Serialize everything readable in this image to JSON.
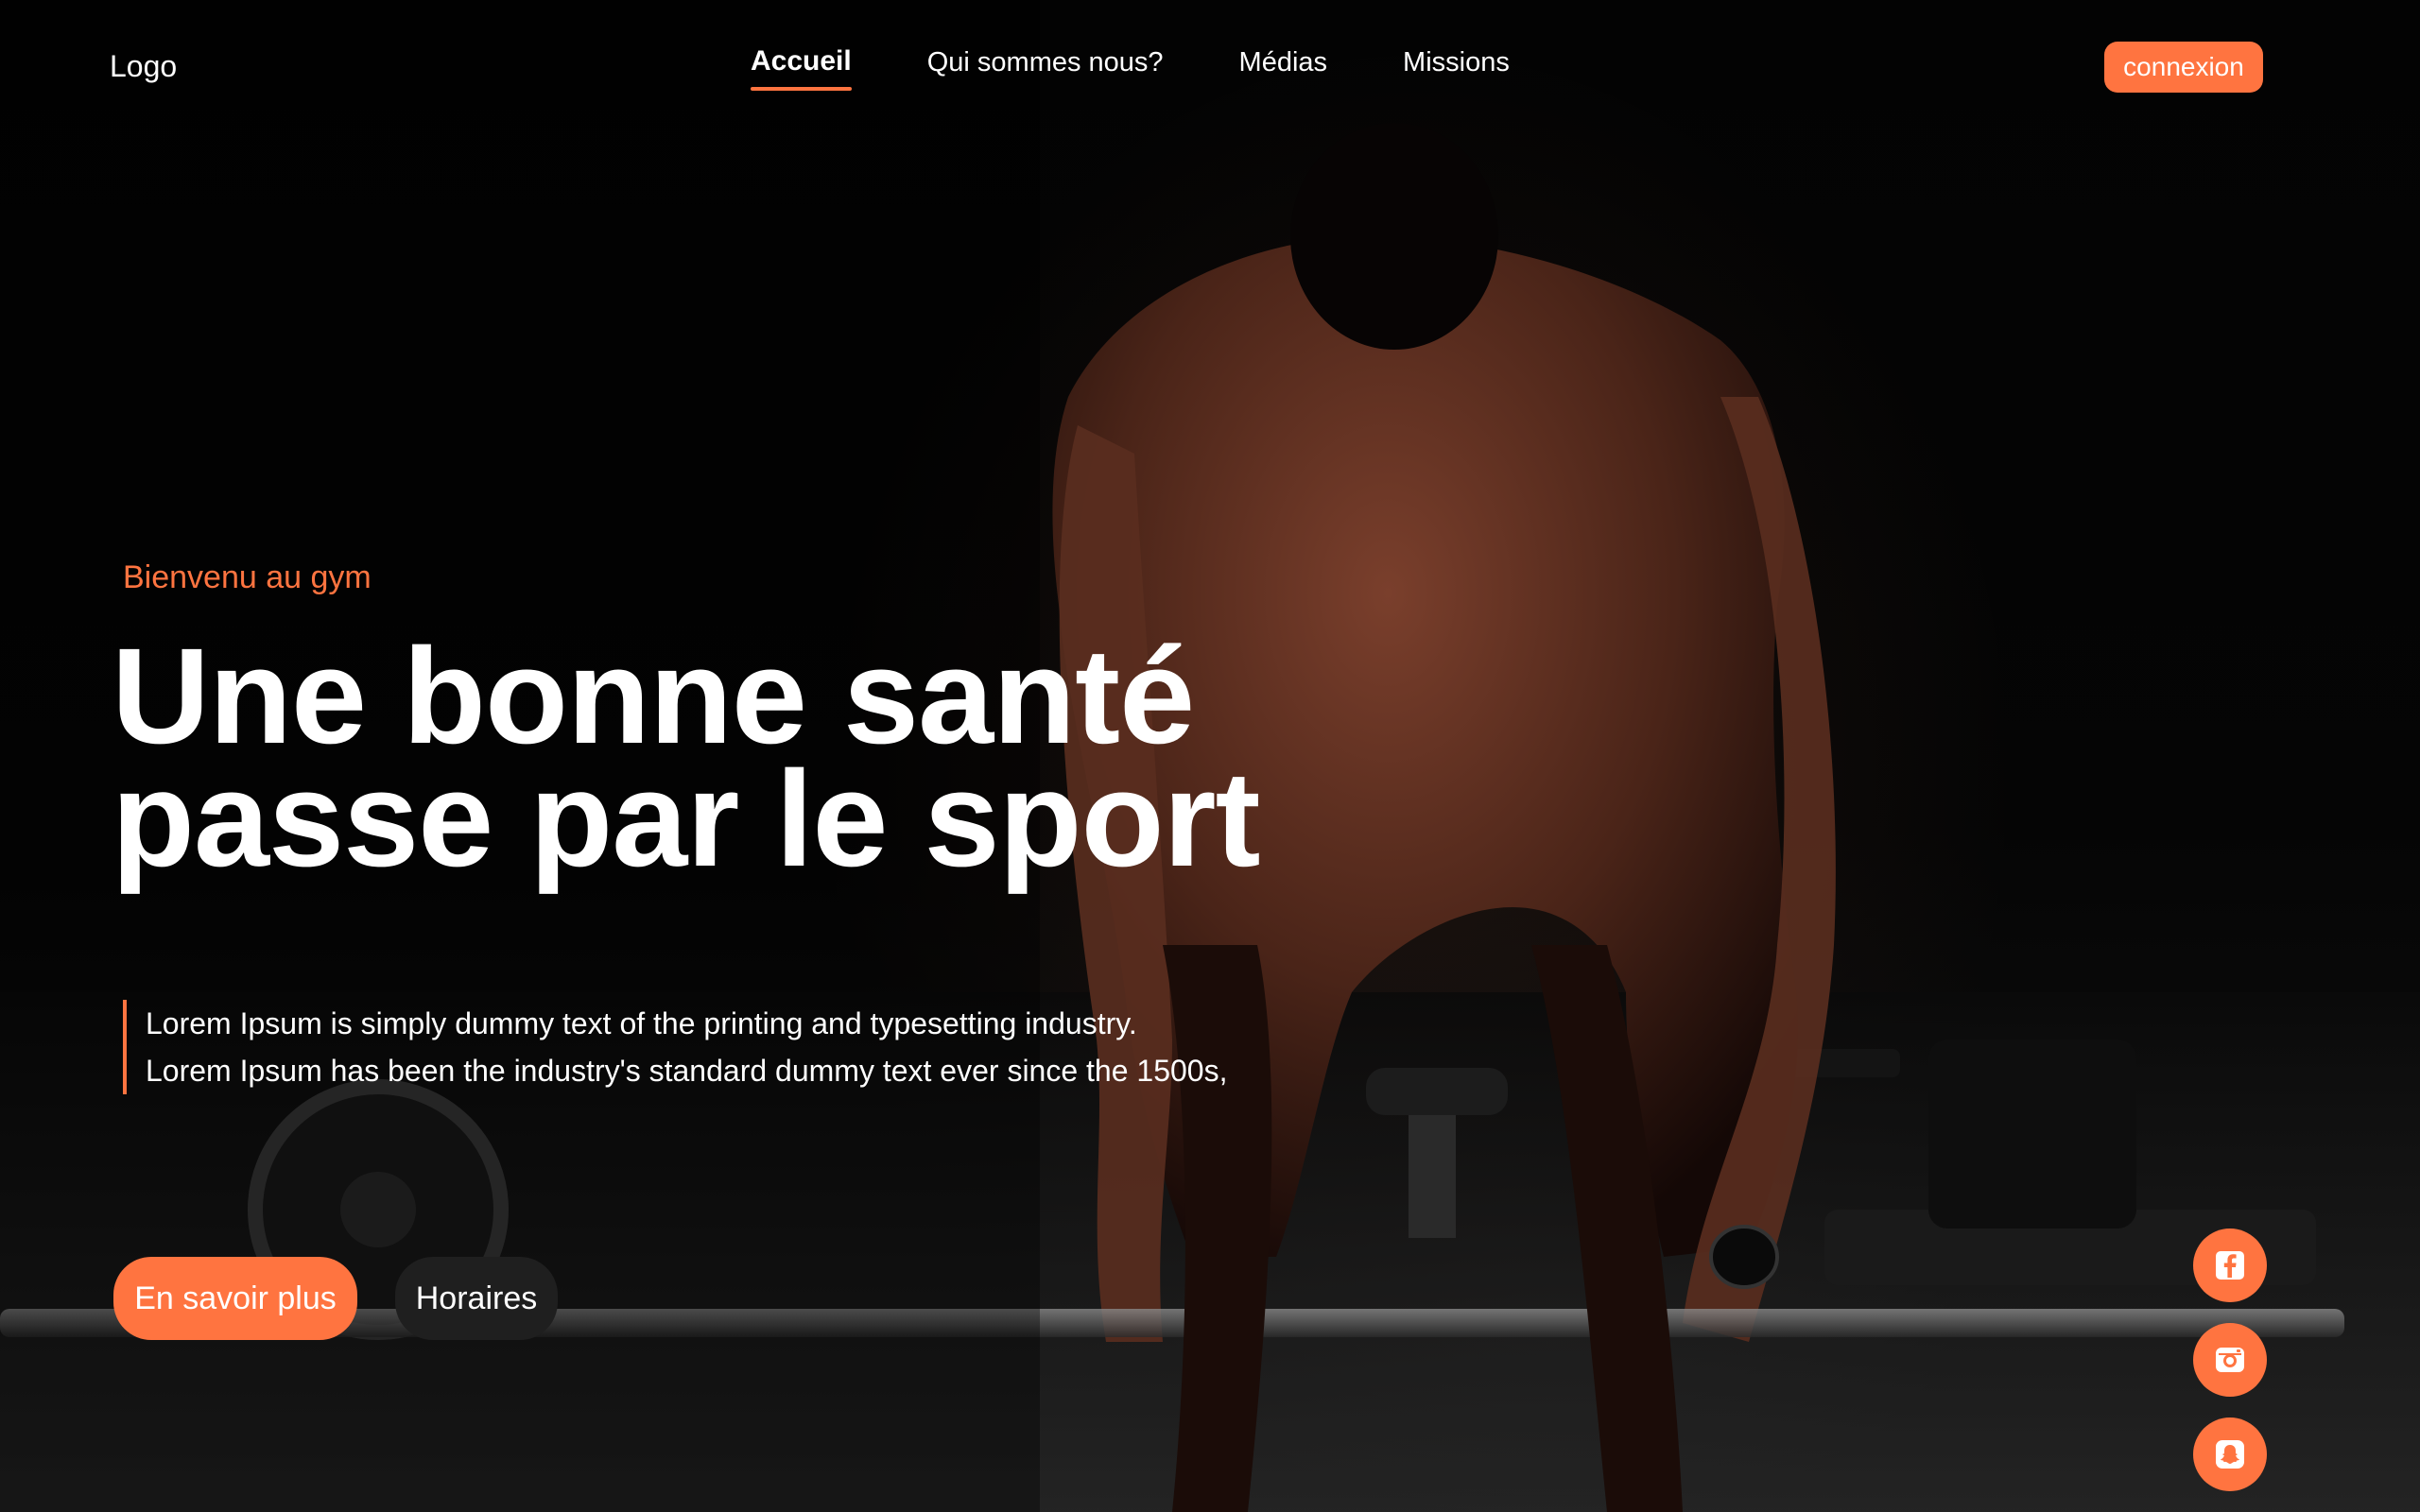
{
  "header": {
    "logo": "Logo",
    "nav": [
      {
        "label": "Accueil",
        "active": true
      },
      {
        "label": "Qui sommes nous?",
        "active": false
      },
      {
        "label": "Médias",
        "active": false
      },
      {
        "label": "Missions",
        "active": false
      }
    ],
    "login_label": "connexion"
  },
  "hero": {
    "kicker": "Bienvenu au gym",
    "title_line1": "Une bonne santé",
    "title_line2": "passe par le sport",
    "description_line1": "Lorem Ipsum is simply dummy text of the printing and typesetting industry.",
    "description_line2": "Lorem Ipsum has been the industry's standard dummy text ever since the 1500s,",
    "primary_cta": "En savoir plus",
    "secondary_cta": "Horaires"
  },
  "social": [
    {
      "icon": "facebook-icon"
    },
    {
      "icon": "instagram-icon"
    },
    {
      "icon": "snapchat-icon"
    }
  ],
  "colors": {
    "accent": "#ff7440",
    "background": "#000000",
    "secondary_button": "#1f1f1f",
    "text": "#ffffff"
  }
}
